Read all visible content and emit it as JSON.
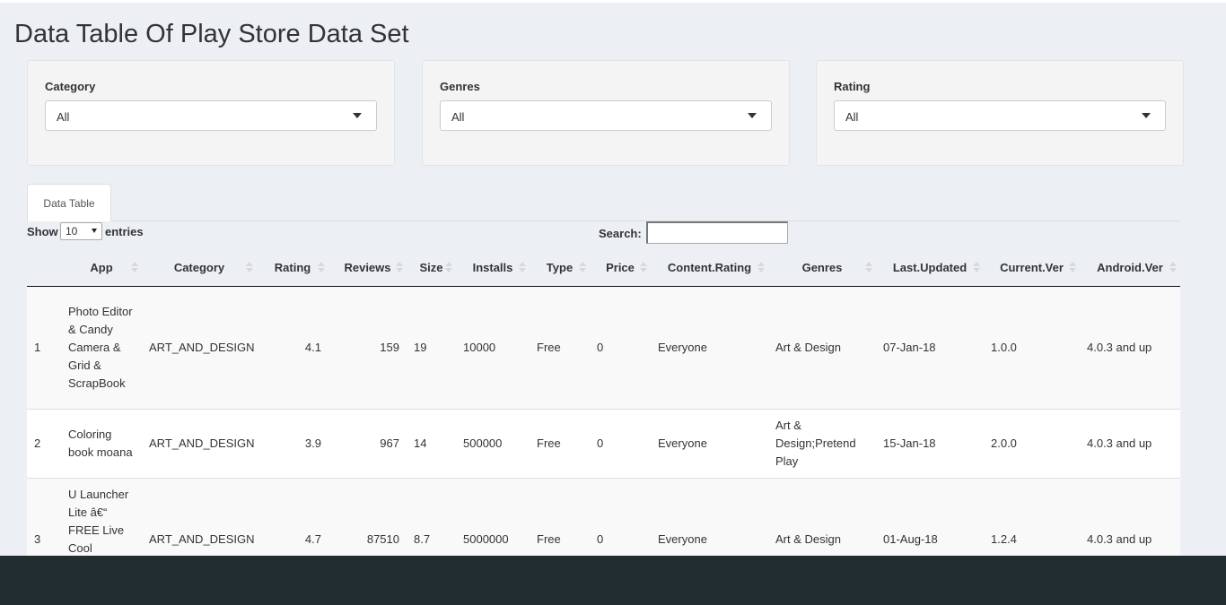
{
  "page": {
    "title": "Data Table Of Play Store Data Set"
  },
  "filters": [
    {
      "label": "Category",
      "value": "All"
    },
    {
      "label": "Genres",
      "value": "All"
    },
    {
      "label": "Rating",
      "value": "All"
    }
  ],
  "tab": {
    "label": "Data Table"
  },
  "controls": {
    "show_label": "Show",
    "entries_value": "10",
    "entries_label": "entries",
    "search_label": "Search:",
    "search_value": ""
  },
  "table": {
    "columns": [
      "",
      "App",
      "Category",
      "Rating",
      "Reviews",
      "Size",
      "Installs",
      "Type",
      "Price",
      "Content.Rating",
      "Genres",
      "Last.Updated",
      "Current.Ver",
      "Android.Ver"
    ],
    "rows": [
      [
        "1",
        "Photo Editor & Candy Camera & Grid & ScrapBook",
        "ART_AND_DESIGN",
        "4.1",
        "159",
        "19",
        "10000",
        "Free",
        "0",
        "Everyone",
        "Art & Design",
        "07-Jan-18",
        "1.0.0",
        "4.0.3 and up"
      ],
      [
        "2",
        "Coloring book moana",
        "ART_AND_DESIGN",
        "3.9",
        "967",
        "14",
        "500000",
        "Free",
        "0",
        "Everyone",
        "Art & Design;Pretend Play",
        "15-Jan-18",
        "2.0.0",
        "4.0.3 and up"
      ],
      [
        "3",
        "U Launcher Lite â€“ FREE Live Cool Themes, Hide Apps",
        "ART_AND_DESIGN",
        "4.7",
        "87510",
        "8.7",
        "5000000",
        "Free",
        "0",
        "Everyone",
        "Art & Design",
        "01-Aug-18",
        "1.2.4",
        "4.0.3 and up"
      ]
    ]
  },
  "colors": {
    "background": "#ecf0f5",
    "panel": "#f4f4f4",
    "bottom_bar": "#222d32"
  }
}
